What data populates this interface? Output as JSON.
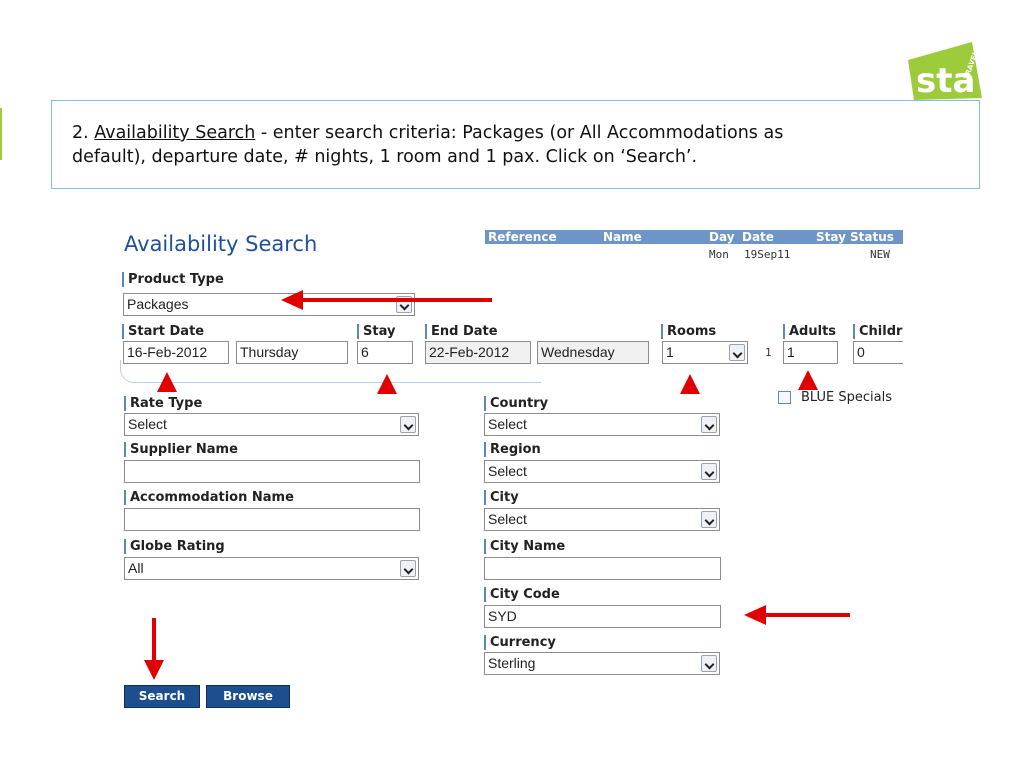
{
  "logo": {
    "text": "sta",
    "subtext": "TRAVEL",
    "color": "#9ccb3b"
  },
  "instruction": {
    "prefix": "2. ",
    "link": "Availability Search",
    "line1_rest": " - enter search criteria: Packages (or All Accommodations as",
    "line2": "default), departure date, # nights, 1 room and 1 pax.  Click on ‘Search’."
  },
  "form": {
    "title": "Availability Search",
    "booking": {
      "headers": {
        "reference": "Reference",
        "name": "Name",
        "day": "Day",
        "date": "Date",
        "stay": "Stay",
        "status": "Status"
      },
      "row": {
        "day": "Mon",
        "date": "19Sep11",
        "status": "NEW"
      }
    },
    "product_type": {
      "label": "Product Type",
      "value": "Packages"
    },
    "start_date": {
      "label": "Start Date",
      "value": "16-Feb-2012",
      "weekday": "Thursday"
    },
    "stay": {
      "label": "Stay",
      "value": "6"
    },
    "end_date": {
      "label": "End Date",
      "value": "22-Feb-2012",
      "weekday": "Wednesday"
    },
    "rooms": {
      "label": "Rooms",
      "value": "1",
      "room_index": "1"
    },
    "adults": {
      "label": "Adults",
      "value": "1"
    },
    "children": {
      "label": "Childr",
      "value": "0"
    },
    "blue_specials": {
      "label": "BLUE Specials",
      "checked": false
    },
    "rate_type": {
      "label": "Rate Type",
      "value": "Select"
    },
    "supplier_name": {
      "label": "Supplier Name",
      "value": ""
    },
    "accommodation_name": {
      "label": "Accommodation Name",
      "value": ""
    },
    "globe_rating": {
      "label": "Globe Rating",
      "value": "All"
    },
    "country": {
      "label": "Country",
      "value": "Select"
    },
    "region": {
      "label": "Region",
      "value": "Select"
    },
    "city": {
      "label": "City",
      "value": "Select"
    },
    "city_name": {
      "label": "City Name",
      "value": ""
    },
    "city_code": {
      "label": "City Code",
      "value": "SYD"
    },
    "currency": {
      "label": "Currency",
      "value": "Sterling"
    },
    "buttons": {
      "search": "Search",
      "browse": "Browse"
    }
  },
  "colors": {
    "accent_blue": "#1f4f9f",
    "header_blue": "#6e95c8",
    "button_blue": "#1d4f8f",
    "arrow_red": "#e00000",
    "box_border": "#7fbfe0"
  }
}
